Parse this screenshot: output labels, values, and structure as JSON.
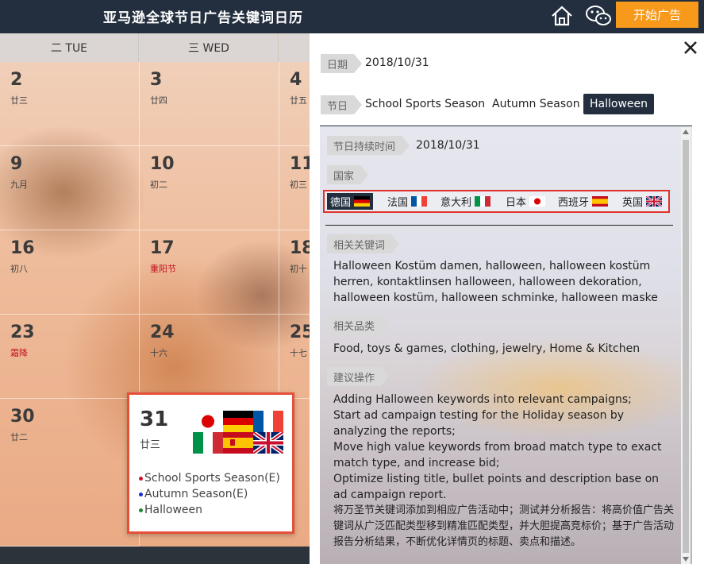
{
  "app": {
    "title": "亚马逊全球节日广告关键词日历",
    "start_label": "开始广告"
  },
  "calendar": {
    "headers": [
      "二 TUE",
      "三 WED"
    ],
    "rows": [
      [
        {
          "num": "2",
          "lunar": "廿三"
        },
        {
          "num": "3",
          "lunar": "廿四"
        },
        {
          "num": "4",
          "lunar": "廿五"
        }
      ],
      [
        {
          "num": "9",
          "lunar": "九月"
        },
        {
          "num": "10",
          "lunar": "初二"
        },
        {
          "num": "11",
          "lunar": "初三"
        }
      ],
      [
        {
          "num": "16",
          "lunar": "初八"
        },
        {
          "num": "17",
          "lunar": "重阳节"
        },
        {
          "num": "18",
          "lunar": "初十"
        }
      ],
      [
        {
          "num": "23",
          "lunar": "霜降"
        },
        {
          "num": "24",
          "lunar": "十六"
        },
        {
          "num": "25",
          "lunar": "十七"
        }
      ],
      [
        {
          "num": "30",
          "lunar": "廿二"
        }
      ]
    ]
  },
  "popup": {
    "num": "31",
    "lunar": "廿三",
    "events": [
      {
        "label": "School Sports Season(E)",
        "color": "#d0112b"
      },
      {
        "label": "Autumn Season(E)",
        "color": "#1f2bd1"
      },
      {
        "label": "Halloween",
        "color": "#1f8a2b"
      }
    ]
  },
  "panel": {
    "date_label": "日期",
    "date_value": "2018/10/31",
    "festival_label": "节日",
    "festivals": [
      "School Sports Season",
      "Autumn Season",
      "Halloween"
    ],
    "duration_label": "节日持续时间",
    "duration_value": "2018/10/31",
    "country_label": "国家",
    "countries": [
      "德国",
      "法国",
      "意大利",
      "日本",
      "西班牙",
      "英国"
    ],
    "keywords_label": "相关关键词",
    "keywords": "Halloween Kostüm damen, halloween, halloween kostüm herren, kontaktlinsen halloween, halloween dekoration, halloween kostüm, halloween schminke, halloween maske",
    "products_label": "相关品类",
    "products": "Food, toys & games, clothing, jewelry, Home & Kitchen",
    "actions_label": "建议操作",
    "actions_en": [
      "Adding Halloween keywords into relevant campaigns;",
      "Start ad campaign testing for the Holiday season by analyzing the reports;",
      "Move high value keywords from broad match type to exact match type, and increase bid;",
      "Optimize listing title, bullet points and description base on ad campaign report."
    ],
    "actions_cn": "将万圣节关键词添加到相应广告活动中；测试并分析报告：将高价值广告关键词从广泛匹配类型移到精准匹配类型，并大胆提高竞标价；基于广告活动报告分析结果，不断优化详情页的标题、卖点和描述。"
  },
  "colors": {
    "topbar": "#232f3e",
    "accent": "#f79a1c",
    "highlight_border": "#e0322b"
  }
}
